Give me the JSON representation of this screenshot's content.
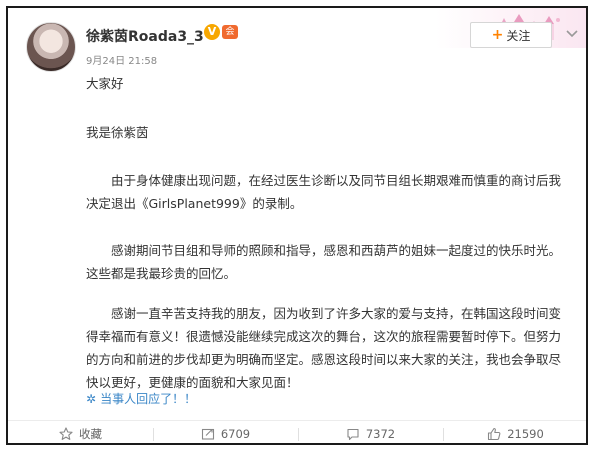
{
  "user": {
    "name": "徐紫茵Roada3_3",
    "verified_badge": "V",
    "member_badge": "会",
    "date": "9月24日",
    "time": "21:58"
  },
  "follow_button": {
    "label": "关注",
    "icon": "plus-icon"
  },
  "post": {
    "greeting": "大家好",
    "intro": "我是徐紫茵",
    "paragraph_1": "由于身体健康出现问题，在经过医生诊断以及同节目组长期艰难而慎重的商讨后我决定退出《GirlsPlanet999》的录制。",
    "paragraph_2": "感谢期间节目组和导师的照顾和指导，感恩和西葫芦的姐妹一起度过的快乐时光。这些都是我最珍贵的回忆。",
    "paragraph_3": "感谢一直辛苦支持我的朋友，因为收到了许多大家的爱与支持，在韩国这段时间变得幸福而有意义！很遗憾没能继续完成这次的舞台，这次的旅程需要暂时停下。但努力的方向和前进的步伐却更为明确而坚定。感恩这段时间以来大家的关注，我也会争取尽快以更好，更健康的面貌和大家见面！"
  },
  "reply_note": {
    "label": "当事人回应了！！",
    "icon": "sparkle-icon"
  },
  "actions": {
    "favorite": {
      "label": "收藏",
      "icon": "star-icon"
    },
    "repost": {
      "count": "6709",
      "icon": "repost-icon"
    },
    "comment": {
      "count": "7372",
      "icon": "comment-icon"
    },
    "like": {
      "count": "21590",
      "icon": "thumbs-up-icon"
    }
  },
  "colors": {
    "accent_orange": "#ff8200",
    "link_blue": "#3a86c7",
    "verified": "#f7a700",
    "text": "#333333",
    "muted": "#888888"
  }
}
